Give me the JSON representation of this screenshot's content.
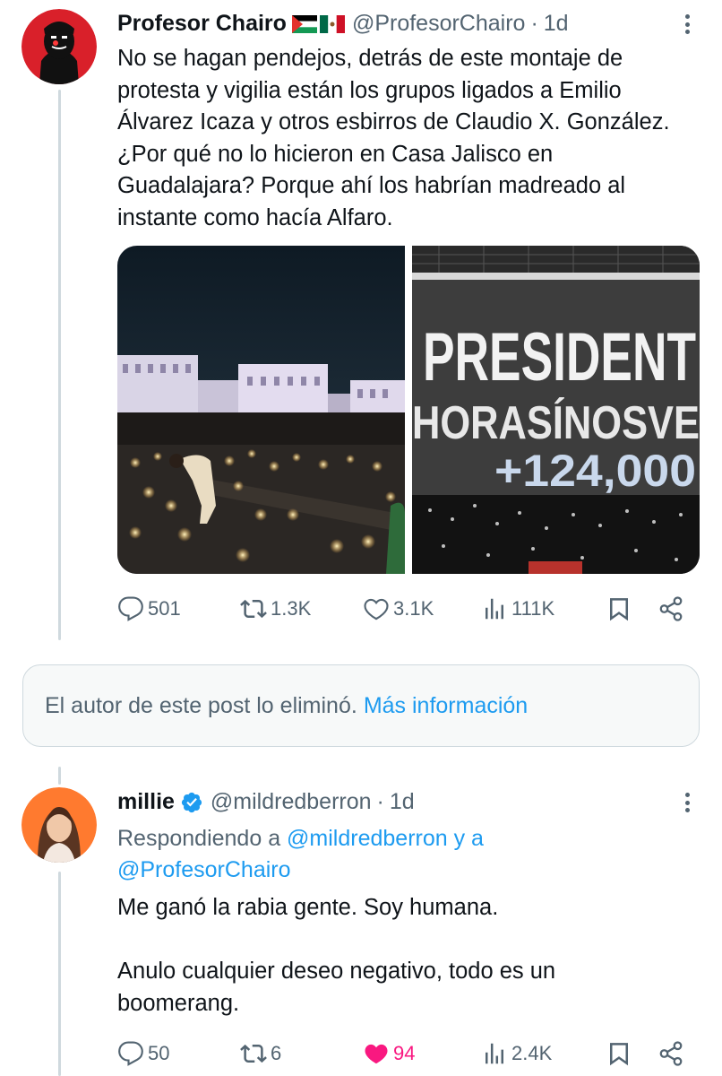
{
  "tweet1": {
    "name": "Profesor Chairo",
    "handle": "@ProfesorChairo",
    "separator": "·",
    "time": "1d",
    "text": "No se hagan pendejos, detrás de este montaje de\nprotesta y vigilia están los grupos ligados a Emilio\nÁlvarez Icaza y otros esbirros de Claudio X. González.\n¿Por qué no lo hicieron en Casa Jalisco en\nGuadalajara? Porque ahí los habrían madreado al\ninstante como hacía Alfaro.",
    "image2_text": [
      "PRESIDENT",
      "HORASÍNOSVE",
      "+124,000"
    ],
    "actions": {
      "replies": "501",
      "reposts": "1.3K",
      "likes": "3.1K",
      "views": "111K"
    }
  },
  "deleted_notice": {
    "text": "El autor de este post lo eliminó.",
    "link": "Más información"
  },
  "tweet2": {
    "name": "millie",
    "handle": "@mildredberron",
    "separator": "·",
    "time": "1d",
    "replying_prefix": "Respondiendo a",
    "replying_to": "@mildredberron y a\n@ProfesorChairo",
    "text": "Me ganó la rabia gente. Soy humana.\n\nAnulo cualquier deseo negativo, todo es un\nboomerang.",
    "actions": {
      "replies": "50",
      "reposts": "6",
      "likes": "94",
      "views": "2.4K"
    }
  },
  "icons": {
    "reply": "reply-icon",
    "repost": "repost-icon",
    "like": "heart-icon",
    "views": "views-icon",
    "bookmark": "bookmark-icon",
    "share": "share-icon",
    "more": "more-icon",
    "verified": "verified-badge-icon",
    "flags": [
      "palestine-flag-icon",
      "mexico-flag-icon"
    ]
  },
  "colors": {
    "text": "#0f1419",
    "secondary": "#536471",
    "link": "#1d9bf0",
    "like": "#f91880",
    "border": "#cfd9de"
  }
}
